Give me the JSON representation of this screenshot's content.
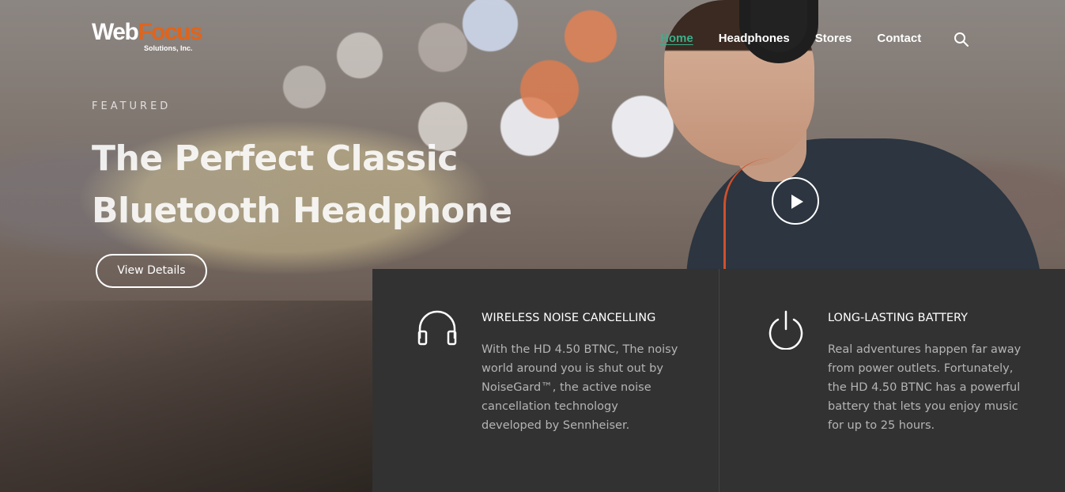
{
  "brand": {
    "name_part1": "Web",
    "name_part2": "Focus",
    "tagline": "Solutions, Inc."
  },
  "nav": {
    "items": [
      {
        "label": "Home",
        "active": true
      },
      {
        "label": "Headphones",
        "active": false
      },
      {
        "label": "Stores",
        "active": false
      },
      {
        "label": "Contact",
        "active": false
      }
    ],
    "search_icon": "search-icon"
  },
  "hero": {
    "eyebrow": "FEATURED",
    "headline_line1": "The Perfect Classic",
    "headline_line2": "Bluetooth Headphone",
    "cta_label": "View Details",
    "play_icon": "play-icon"
  },
  "features": [
    {
      "icon": "headphones-icon",
      "title": "WIRELESS NOISE CANCELLING",
      "text": "With the HD 4.50 BTNC, The noisy world around you is shut out by NoiseGard™, the active noise cancellation technology developed by Sennheiser."
    },
    {
      "icon": "power-icon",
      "title": "LONG-LASTING BATTERY",
      "text": "Real adventures happen far away from power outlets. Fortunately, the HD 4.50 BTNC has a powerful battery that lets you enjoy music for up to 25 hours."
    }
  ],
  "colors": {
    "accent": "#3ab08a",
    "brand_orange": "#e0641b",
    "panel_bg": "#323232"
  }
}
